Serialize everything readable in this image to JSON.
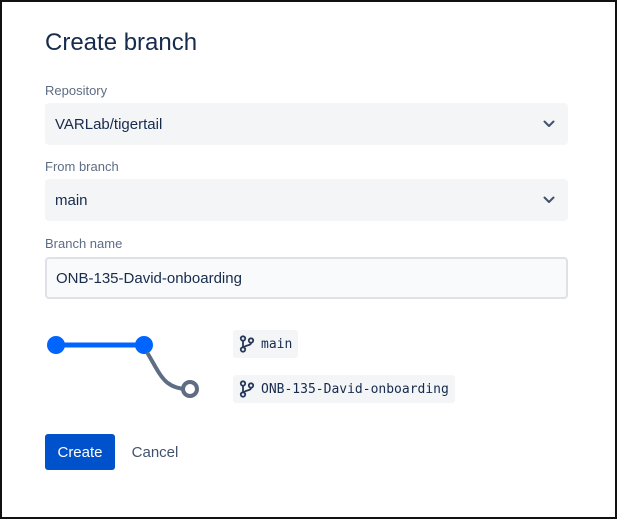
{
  "dialog": {
    "title": "Create branch"
  },
  "form": {
    "repository": {
      "label": "Repository",
      "value": "VARLab/tigertail"
    },
    "from_branch": {
      "label": "From branch",
      "value": "main"
    },
    "branch_name": {
      "label": "Branch name",
      "value": "ONB-135-David-onboarding"
    }
  },
  "diagram": {
    "source_branch": "main",
    "new_branch": "ONB-135-David-onboarding",
    "colors": {
      "source": "#0065ff",
      "new": "#5e6c84"
    }
  },
  "actions": {
    "create_label": "Create",
    "cancel_label": "Cancel"
  },
  "colors": {
    "primary": "#0052cc",
    "text": "#172b4d",
    "subtle_text": "#5e6c84",
    "field_bg": "#f4f5f7"
  },
  "icons": {
    "dropdown": "chevron-down-icon",
    "branch": "git-branch-icon"
  }
}
